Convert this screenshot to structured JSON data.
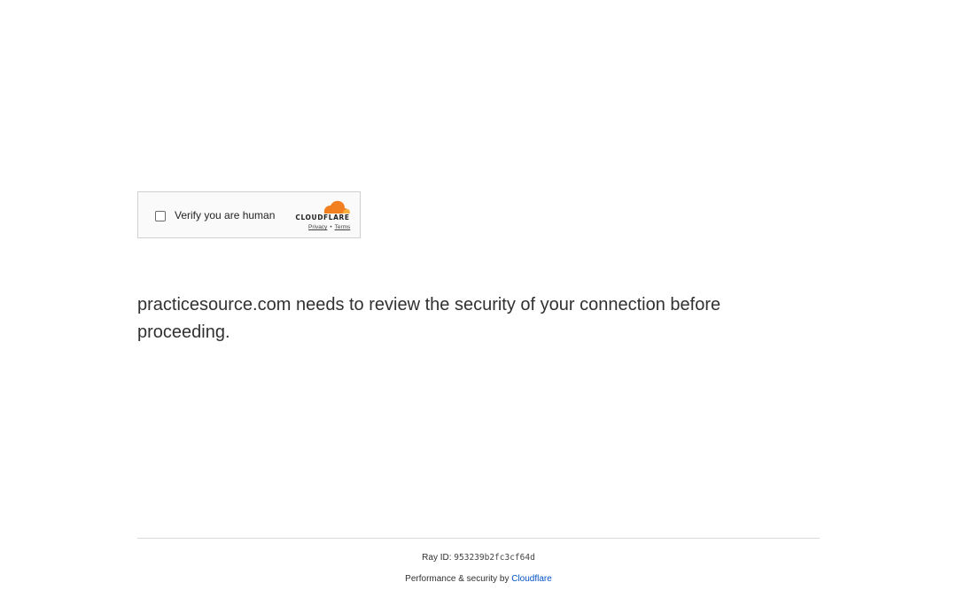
{
  "challenge": {
    "checkbox_label": "Verify you are human",
    "provider_wordmark": "CLOUDFLARE",
    "privacy_link": "Privacy",
    "separator": "•",
    "terms_link": "Terms",
    "brand_colors": {
      "orange": "#f38020",
      "light_orange": "#faae40"
    }
  },
  "main": {
    "message": "practicesource.com needs to review the security of your connection before proceeding."
  },
  "footer": {
    "ray_label": "Ray ID: ",
    "ray_id": "953239b2fc3cf64d",
    "performance_label": "Performance & security by ",
    "performance_link": "Cloudflare",
    "link_color": "#0051c3"
  }
}
